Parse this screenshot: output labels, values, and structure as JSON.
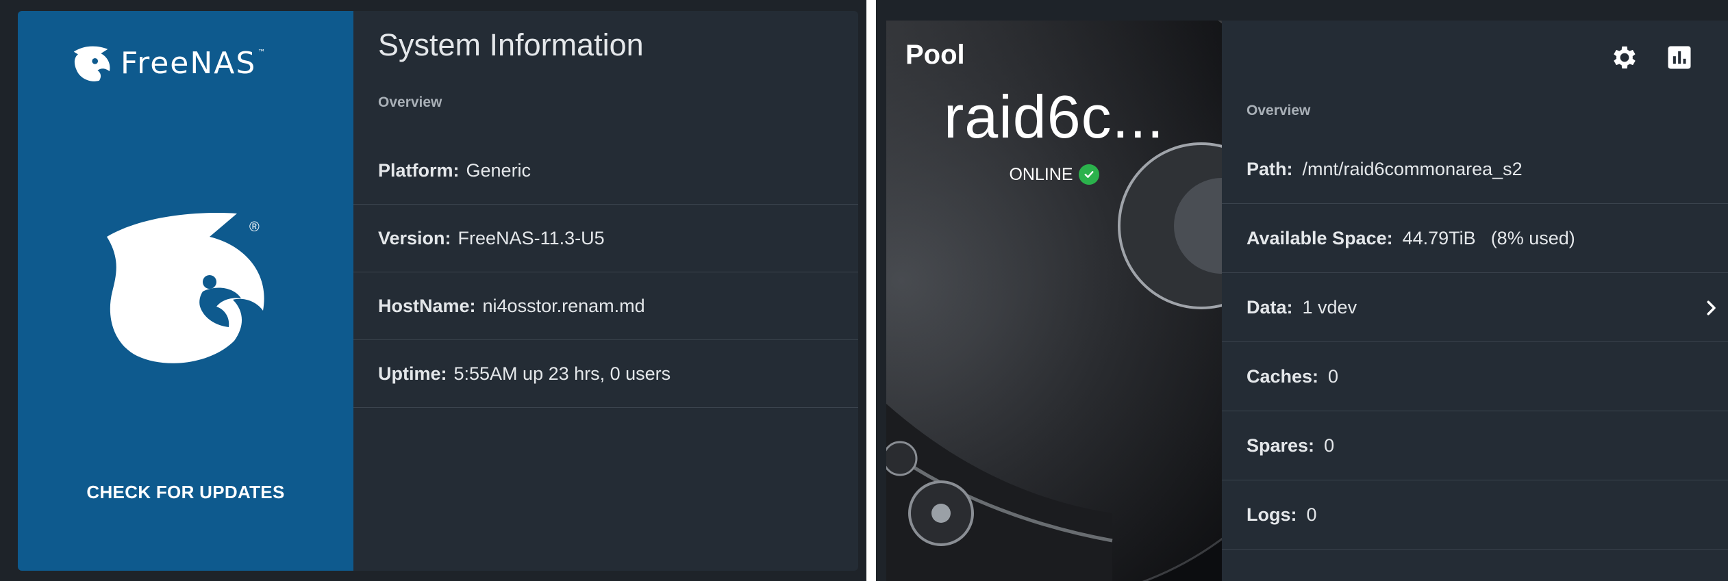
{
  "system": {
    "brand_name": "FreeNAS",
    "trademark": "™",
    "registered": "®",
    "check_updates": "CHECK FOR UPDATES",
    "title": "System Information",
    "overview": "Overview",
    "rows": [
      {
        "key": "Platform:",
        "value": "Generic"
      },
      {
        "key": "Version:",
        "value": "FreeNAS-11.3-U5"
      },
      {
        "key": "HostName:",
        "value": "ni4osstor.renam.md"
      },
      {
        "key": "Uptime:",
        "value": "5:55AM up 23 hrs, 0 users"
      }
    ]
  },
  "pool": {
    "label": "Pool",
    "name": "raid6c...",
    "status": "ONLINE",
    "overview": "Overview",
    "rows": [
      {
        "key": "Path:",
        "value": "/mnt/raid6commonarea_s2",
        "sub": ""
      },
      {
        "key": "Available Space:",
        "value": "44.79TiB",
        "sub": "(8% used)"
      },
      {
        "key": "Data:",
        "value": "1 vdev",
        "sub": ""
      },
      {
        "key": "Caches:",
        "value": "0",
        "sub": ""
      },
      {
        "key": "Spares:",
        "value": "0",
        "sub": ""
      },
      {
        "key": "Logs:",
        "value": "0",
        "sub": ""
      }
    ],
    "icons": {
      "settings": "gear-icon",
      "stats": "bar-chart-icon",
      "expand": "chevron-right-icon",
      "status": "check-circle-icon"
    }
  },
  "colors": {
    "brand_blue": "#0e5a8e",
    "card_bg": "#242c35",
    "page_bg": "#1e2329",
    "online_green": "#2bb24c"
  }
}
